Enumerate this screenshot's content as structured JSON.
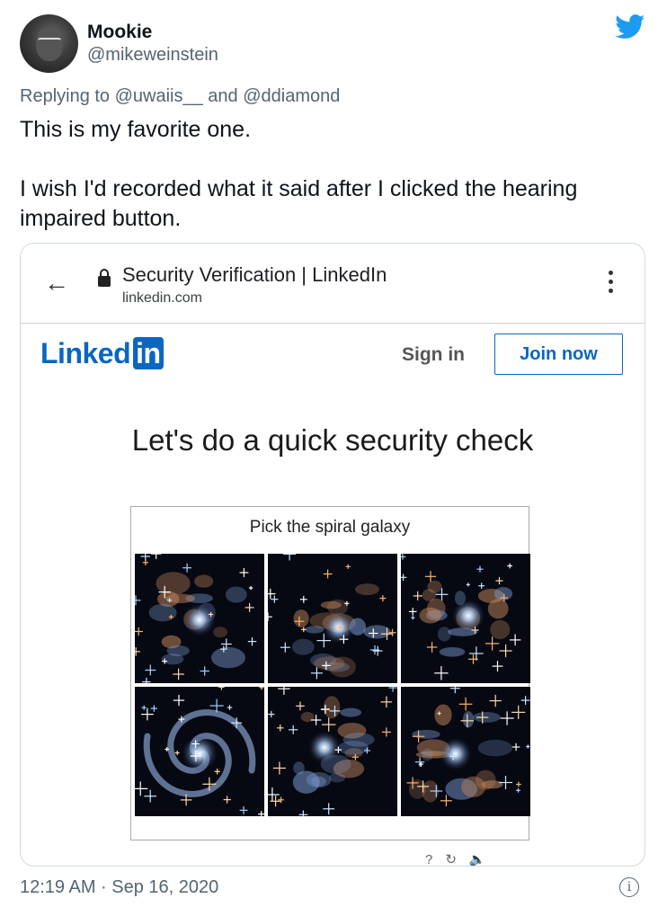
{
  "author": {
    "name": "Mookie",
    "handle": "@mikeweinstein"
  },
  "reply_context": "Replying to @uwaiis__ and @ddiamond",
  "tweet": {
    "line1": "This is my favorite one.",
    "line2": "I wish I'd recorded what it said after I clicked the hearing impaired button."
  },
  "screenshot": {
    "browser": {
      "page_title": "Security Verification | LinkedIn",
      "url": "linkedin.com",
      "back_icon": "back-arrow-icon",
      "menu_icon": "kebab-menu-icon"
    },
    "linkedin": {
      "logo_word": "Linked",
      "logo_badge": "in",
      "brand_color": "#0a66c2",
      "sign_in": "Sign in",
      "join_now": "Join now",
      "headline": "Let's do a quick security check",
      "captcha": {
        "instruction": "Pick the spiral galaxy",
        "tiles": [
          "galaxy-image",
          "galaxy-image",
          "galaxy-image",
          "spiral-galaxy-image",
          "galaxy-image",
          "galaxy-image"
        ],
        "controls": [
          "help-icon",
          "reload-icon",
          "audio-icon"
        ]
      }
    }
  },
  "timestamp": "12:19 AM · Sep 16, 2020",
  "icons": {
    "twitter": "twitter-bird-icon",
    "info": "info-icon"
  },
  "colors": {
    "twitter_blue": "#1d9bf0",
    "secondary_text": "#536471"
  }
}
